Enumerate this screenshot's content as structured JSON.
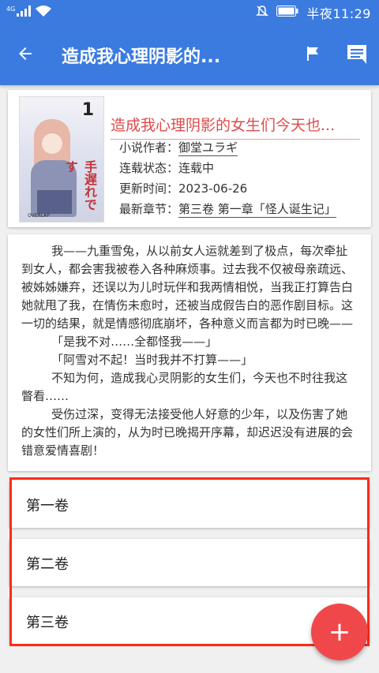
{
  "status_bar": {
    "network_tag": "4G",
    "time": "半夜11:29",
    "icons": [
      "signal-icon",
      "wifi-icon",
      "mute-icon",
      "battery-icon"
    ]
  },
  "app_bar": {
    "title": "造成我心理阴影的...",
    "back_icon": "arrow-left-icon",
    "actions": [
      "flag-icon",
      "comment-icon"
    ]
  },
  "book": {
    "title": "造成我心理阴影的女生们今天也...",
    "cover": {
      "volume_number": "1",
      "red_text": "手遅れです",
      "publisher": "OVERLAP"
    },
    "meta": [
      {
        "label": "小说作者：",
        "value": "御堂ユラギ",
        "link": true
      },
      {
        "label": "连载状态：",
        "value": "连载中",
        "link": false
      },
      {
        "label": "更新时间：",
        "value": "2023-06-26",
        "link": false
      },
      {
        "label": "最新章节：",
        "value": "第三卷 第一章「怪人诞生记」",
        "link": true
      }
    ]
  },
  "synopsis": "        我——九重雪兔，从以前女人运就差到了极点，每次牵扯到女人，都会害我被卷入各种麻烦事。过去我不仅被母亲疏远、被姊姊嫌弃，还误以为儿时玩伴和我两情相悦，当我正打算告白她就甩了我，在情伤未愈时，还被当成假告白的恶作剧目标。这一切的结果，就是情感彻底崩坏，各种意义而言都为时已晚——\n        「是我不对……全都怪我——」\n        「阿雪对不起！当时我并不打算——」\n        不知为何，造成我心灵阴影的女生们，今天也不时往我这瞥看……\n        受伤过深，变得无法接受他人好意的少年，以及伤害了她的女性们所上演的，从为时已晚揭开序幕，却迟迟没有进展的会错意爱情喜剧！",
  "volumes": [
    "第一卷",
    "第二卷",
    "第三卷"
  ],
  "fab": {
    "symbol": "+",
    "icon": "plus-icon"
  },
  "colors": {
    "primary": "#3b7be0",
    "accent": "#f0484a",
    "title_red": "#e04a4a",
    "highlight": "#ff2a18"
  }
}
